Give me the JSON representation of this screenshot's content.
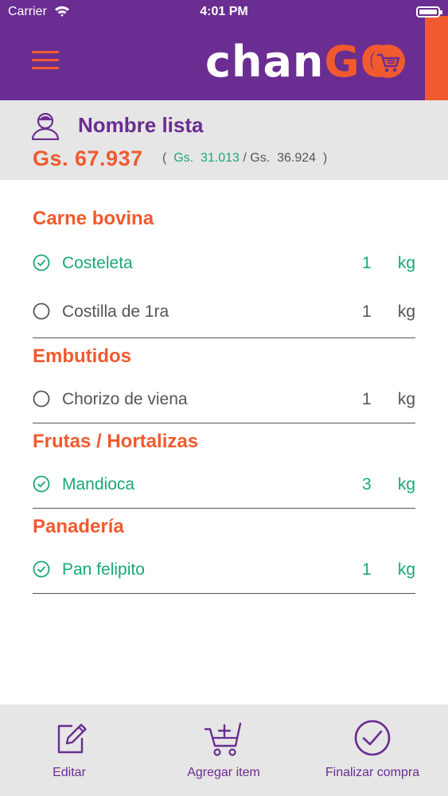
{
  "status_bar": {
    "carrier": "Carrier",
    "time": "4:01 PM"
  },
  "header": {
    "logo_text": "chan",
    "logo_accent": "GO",
    "brand_color": "#6a2d91",
    "accent_color": "#f05a2e"
  },
  "list": {
    "name": "Nombre lista",
    "total": "Gs. 67.937",
    "open_paren": "(",
    "checked_total": "Gs.  31.013",
    "separator": "/",
    "remaining_total": "Gs.  36.924",
    "close_paren": ")"
  },
  "categories": [
    {
      "title": "Carne bovina",
      "items": [
        {
          "name": "Costeleta",
          "qty": "1",
          "unit": "kg",
          "checked": true
        },
        {
          "name": "Costilla de 1ra",
          "qty": "1",
          "unit": "kg",
          "checked": false
        }
      ]
    },
    {
      "title": "Embutidos",
      "items": [
        {
          "name": "Chorizo de viena",
          "qty": "1",
          "unit": "kg",
          "checked": false
        }
      ]
    },
    {
      "title": "Frutas / Hortalizas",
      "items": [
        {
          "name": "Mandioca",
          "qty": "3",
          "unit": "kg",
          "checked": true
        }
      ]
    },
    {
      "title": "Panadería",
      "items": [
        {
          "name": "Pan felipito",
          "qty": "1",
          "unit": "kg",
          "checked": true
        }
      ]
    }
  ],
  "bottom_bar": {
    "edit": "Editar",
    "add": "Agregar item",
    "finish": "Finalizar compra"
  }
}
